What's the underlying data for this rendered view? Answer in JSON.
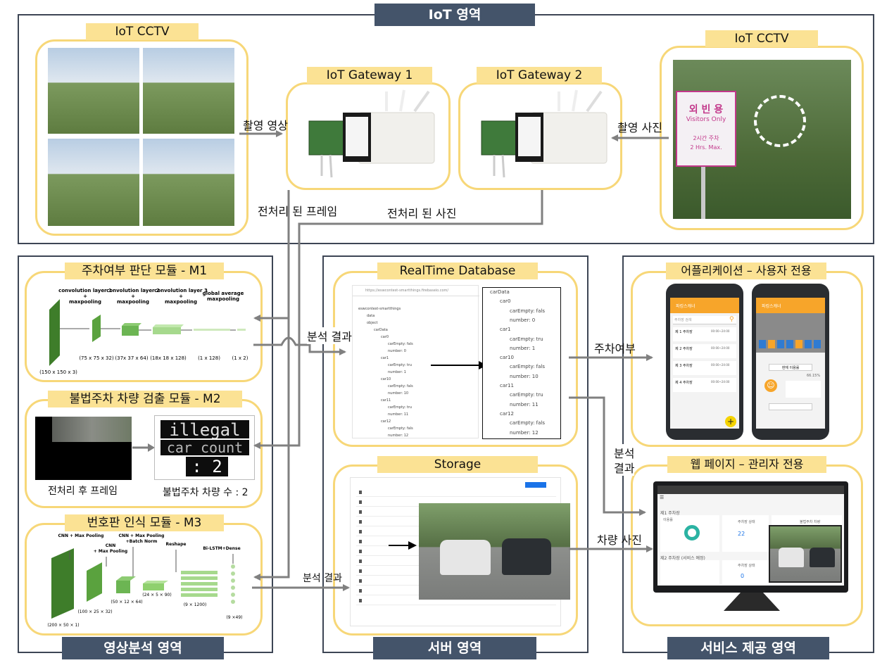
{
  "regions": {
    "iot": "IoT 영역",
    "analysis": "영상분석 영역",
    "server": "서버 영역",
    "service": "서비스 제공 영역"
  },
  "cards": {
    "cctv_left": "IoT CCTV",
    "gateway1": "IoT Gateway 1",
    "gateway2": "IoT Gateway 2",
    "cctv_right": "IoT CCTV",
    "m1": "주차여부 판단 모듈 - M1",
    "m2": "불법주차 차량 검출 모듈 - M2",
    "m3": "번호판 인식 모듈 - M3",
    "rtdb": "RealTime Database",
    "storage": "Storage",
    "app": "어플리케이션 – 사용자 전용",
    "web": "웹 페이지 – 관리자 전용"
  },
  "arrows": {
    "video": "촬영 영상",
    "photo": "촬영 사진",
    "frame": "전처리 된 프레임",
    "photo_pre": "전처리 된 사진",
    "result1": "분석 결과",
    "result2": "분석 결과",
    "parking": "주차여부",
    "result3_a": "분석",
    "result3_b": "결과",
    "car_photo": "차량 사진"
  },
  "sign": {
    "line1": "외 빈 용",
    "line2": "Visitors Only",
    "line3": "2시간 주차",
    "line4": "2 Hrs. Max."
  },
  "m1": {
    "layers": [
      "convolution layer 1",
      "+",
      "maxpooling",
      "convolution layer 2",
      "+",
      "maxpooling",
      "convolution layer 3",
      "+",
      "maxpooling",
      "global average",
      "maxpooling"
    ],
    "dims": [
      "(150 x 150 x 3)",
      "(75 x 75 x 32)",
      "(37x 37 x 64)",
      "(18x 18 x 128)",
      "(1 x 128)",
      "(1 x 2)"
    ]
  },
  "m2": {
    "lcd1": "illegal",
    "lcd2": "car count",
    "lcd3": ": 2",
    "caption_left": "전처리 후 프레임",
    "caption_right": "불법주차 차량 수 : 2"
  },
  "m3": {
    "layers": [
      "CNN + Max Pooling",
      "CNN",
      "+ Max Pooling",
      "CNN + Max Pooling",
      "+Batch Norm",
      "Reshape",
      "Bi-LSTM+Dense"
    ],
    "dims": [
      "(200 × 50 × 1)",
      "(100 × 25 × 32)",
      "(50 × 12 × 64)",
      "(24 × 5 × 90)",
      "(9 × 1200)",
      "(9 ×49)"
    ]
  },
  "rtdb": {
    "url": "https://eswcontest-smartthings.firebaseio.com/",
    "root": "eswcontest-smartthings",
    "left_tree": [
      "data",
      "object",
      "carData",
      "car0",
      "carEmpty: fals",
      "number: 0",
      "car1",
      "carEmpty: tru",
      "number: 1",
      "car10",
      "carEmpty: fals",
      "number: 10",
      "car11",
      "carEmpty: tru",
      "number: 11",
      "car12",
      "carEmpty: fals",
      "number: 12"
    ],
    "zoom_tree": [
      "carData",
      "car0",
      "carEmpty: fals",
      "number: 0",
      "car1",
      "carEmpty: tru",
      "number: 1",
      "car10",
      "carEmpty: fals",
      "number: 10",
      "car11",
      "carEmpty: tru",
      "number: 11",
      "car12",
      "carEmpty: fals",
      "number: 12"
    ]
  },
  "app": {
    "header": "파킹스캐너",
    "search": "주차장 검색",
    "lots": [
      "제 1 주차장",
      "제 2 주차장",
      "제 3 주차장",
      "제 4 주차장"
    ],
    "hours": "00:00~24:00",
    "detail_button": "현재 이용률",
    "percent": "66.15%"
  },
  "web": {
    "lot1": "제1 주차장",
    "lot2": "제2 주차장 (서비스 예정)",
    "status": "주차장 상태",
    "usage": "이용률",
    "illegal": "불법주차 차량",
    "count": "22",
    "zero": "0"
  },
  "colors": {
    "card_border": "#f7d778",
    "card_title": "#fbe294",
    "region_label": "#44546a",
    "module_green": "#3e7d2a",
    "app_orange": "#f7a52a"
  }
}
